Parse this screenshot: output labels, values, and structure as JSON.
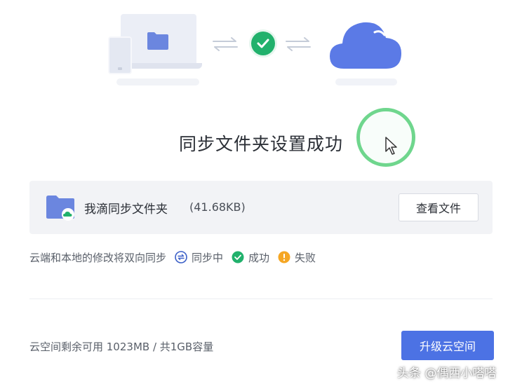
{
  "illustration": {
    "device_folder_icon": "folder-icon",
    "arrows_icon": "sync-arrows-icon",
    "status_icon": "checkmark-icon",
    "cloud_icon": "cloud-icon"
  },
  "title": "同步文件夹设置成功",
  "folder": {
    "name": "我滴同步文件夹",
    "size": "(41.68KB)",
    "view_button_label": "查看文件"
  },
  "legend": {
    "description": "云端和本地的修改将双向同步",
    "items": [
      {
        "icon": "syncing-icon",
        "label": "同步中"
      },
      {
        "icon": "success-icon",
        "label": "成功"
      },
      {
        "icon": "failed-icon",
        "label": "失败"
      }
    ]
  },
  "footer": {
    "storage_text": "云空间剩余可用 1023MB / 共1GB容量",
    "upgrade_button_label": "升级云空间"
  },
  "watermark": "头条 @偶西小嗒嗒",
  "colors": {
    "primary": "#4c72e4",
    "success": "#21b16c",
    "warning": "#f5a623",
    "syncing": "#3b5fc7",
    "folder": "#6b86df"
  }
}
